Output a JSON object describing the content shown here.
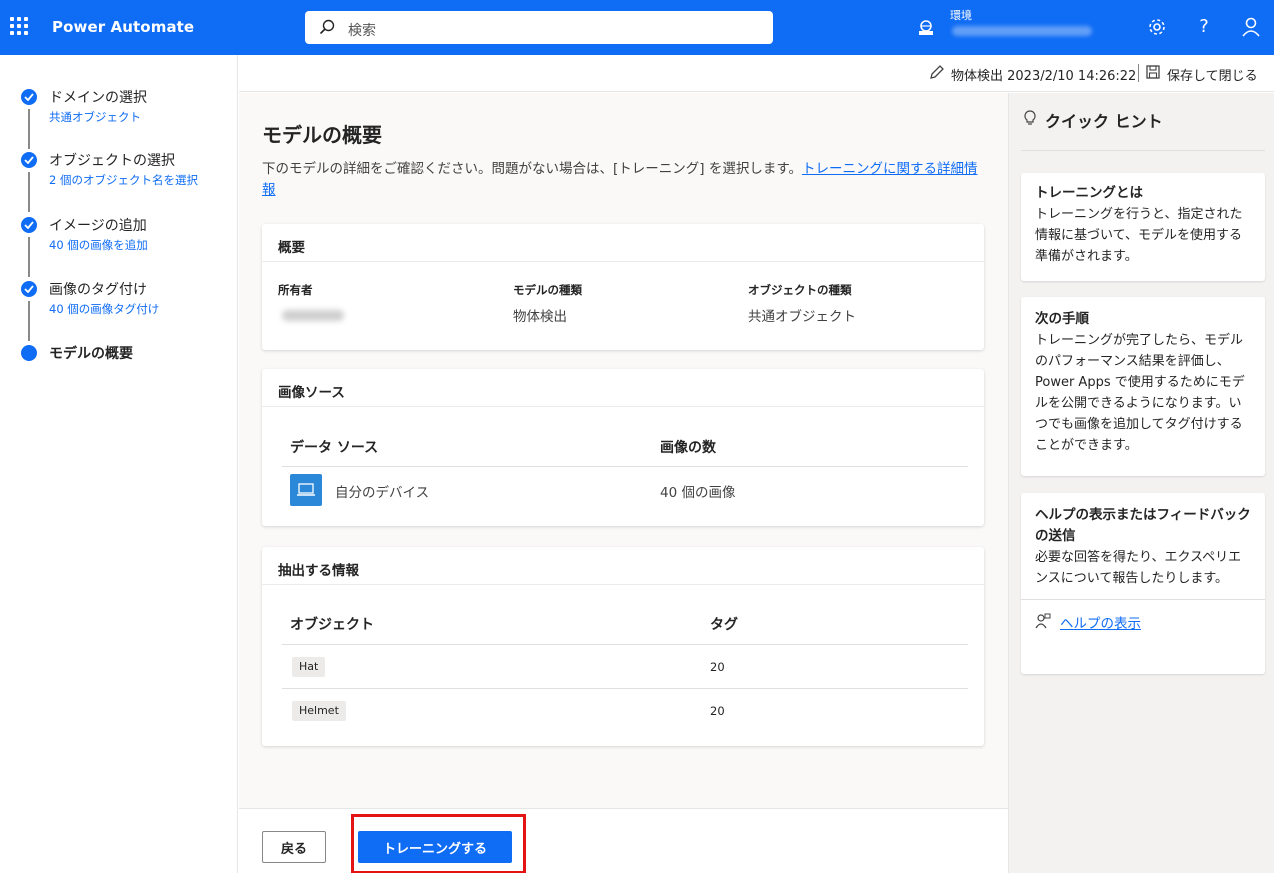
{
  "colors": {
    "brand": "#0f6cf5",
    "highlight": "#e21414"
  },
  "topbar": {
    "app_title": "Power Automate",
    "search_placeholder": "検索",
    "env_label": "環境",
    "icons": [
      "waffle-icon",
      "search-icon",
      "environment-icon",
      "gear-icon",
      "help-icon",
      "account-icon"
    ],
    "help_glyph": "?"
  },
  "steps": [
    {
      "title": "ドメインの選択",
      "sub": "共通オブジェクト",
      "done": true
    },
    {
      "title": "オブジェクトの選択",
      "sub": "2 個のオブジェクト名を選択",
      "done": true
    },
    {
      "title": "イメージの追加",
      "sub": "40 個の画像を追加",
      "done": true
    },
    {
      "title": "画像のタグ付け",
      "sub": "40 個の画像タグ付け",
      "done": true
    },
    {
      "title": "モデルの概要",
      "sub": "",
      "done": false,
      "current": true
    }
  ],
  "cmdbar": {
    "model_info": "物体検出 2023/2/10 14:26:22",
    "save_close": "保存して閉じる"
  },
  "main": {
    "title": "モデルの概要",
    "desc": "下のモデルの詳細をご確認ください。問題がない場合は、[トレーニング] を選択します。",
    "desc_link": "トレーニングに関する詳細情報",
    "overview": {
      "header": "概要",
      "owner_label": "所有者",
      "model_type_label": "モデルの種類",
      "model_type_value": "物体検出",
      "object_type_label": "オブジェクトの種類",
      "object_type_value": "共通オブジェクト"
    },
    "image_source": {
      "header": "画像ソース",
      "col_source": "データ ソース",
      "col_count": "画像の数",
      "rows": [
        {
          "source": "自分のデバイス",
          "count": "40 個の画像"
        }
      ]
    },
    "extract": {
      "header": "抽出する情報",
      "col_object": "オブジェクト",
      "col_tag": "タグ",
      "rows": [
        {
          "object": "Hat",
          "tag": "20"
        },
        {
          "object": "Helmet",
          "tag": "20"
        }
      ]
    }
  },
  "footer": {
    "back_label": "戻る",
    "train_label": "トレーニングする"
  },
  "hints": {
    "title": "クイック ヒント",
    "cards": [
      {
        "title": "トレーニングとは",
        "body": "トレーニングを行うと、指定された情報に基づいて、モデルを使用する準備がされます。"
      },
      {
        "title": "次の手順",
        "body": "トレーニングが完了したら、モデルのパフォーマンス結果を評価し、Power Apps で使用するためにモデルを公開できるようになります。いつでも画像を追加してタグ付けすることができます。"
      },
      {
        "title": "ヘルプの表示またはフィードバックの送信",
        "body": "必要な回答を得たり、エクスペリエンスについて報告したりします。",
        "link": "ヘルプの表示"
      }
    ]
  }
}
